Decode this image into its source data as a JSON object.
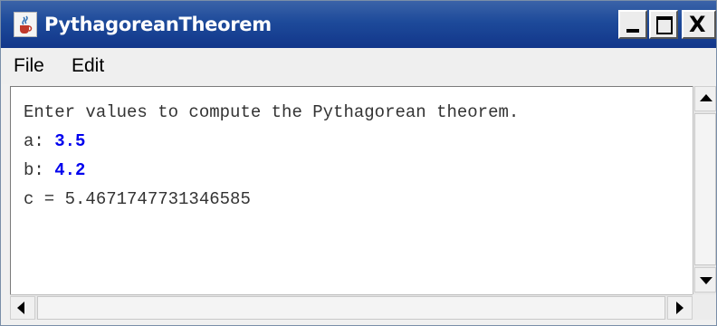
{
  "window": {
    "title": "PythagoreanTheorem",
    "icon": "java-cup-icon",
    "controls": {
      "minimize": "minimize-icon",
      "maximize": "maximize-icon",
      "close": "close-icon",
      "close_glyph": "X"
    }
  },
  "menu": {
    "items": [
      {
        "label": "File"
      },
      {
        "label": "Edit"
      }
    ]
  },
  "console": {
    "prompt": "Enter values to compute the Pythagorean theorem.",
    "a_label": "a: ",
    "a_value": "3.5",
    "b_label": "b: ",
    "b_value": "4.2",
    "result": "c = 5.4671747731346585"
  },
  "colors": {
    "title_bar": "#1d4a9a",
    "input_value": "#0000ee",
    "output_text": "#333333"
  }
}
